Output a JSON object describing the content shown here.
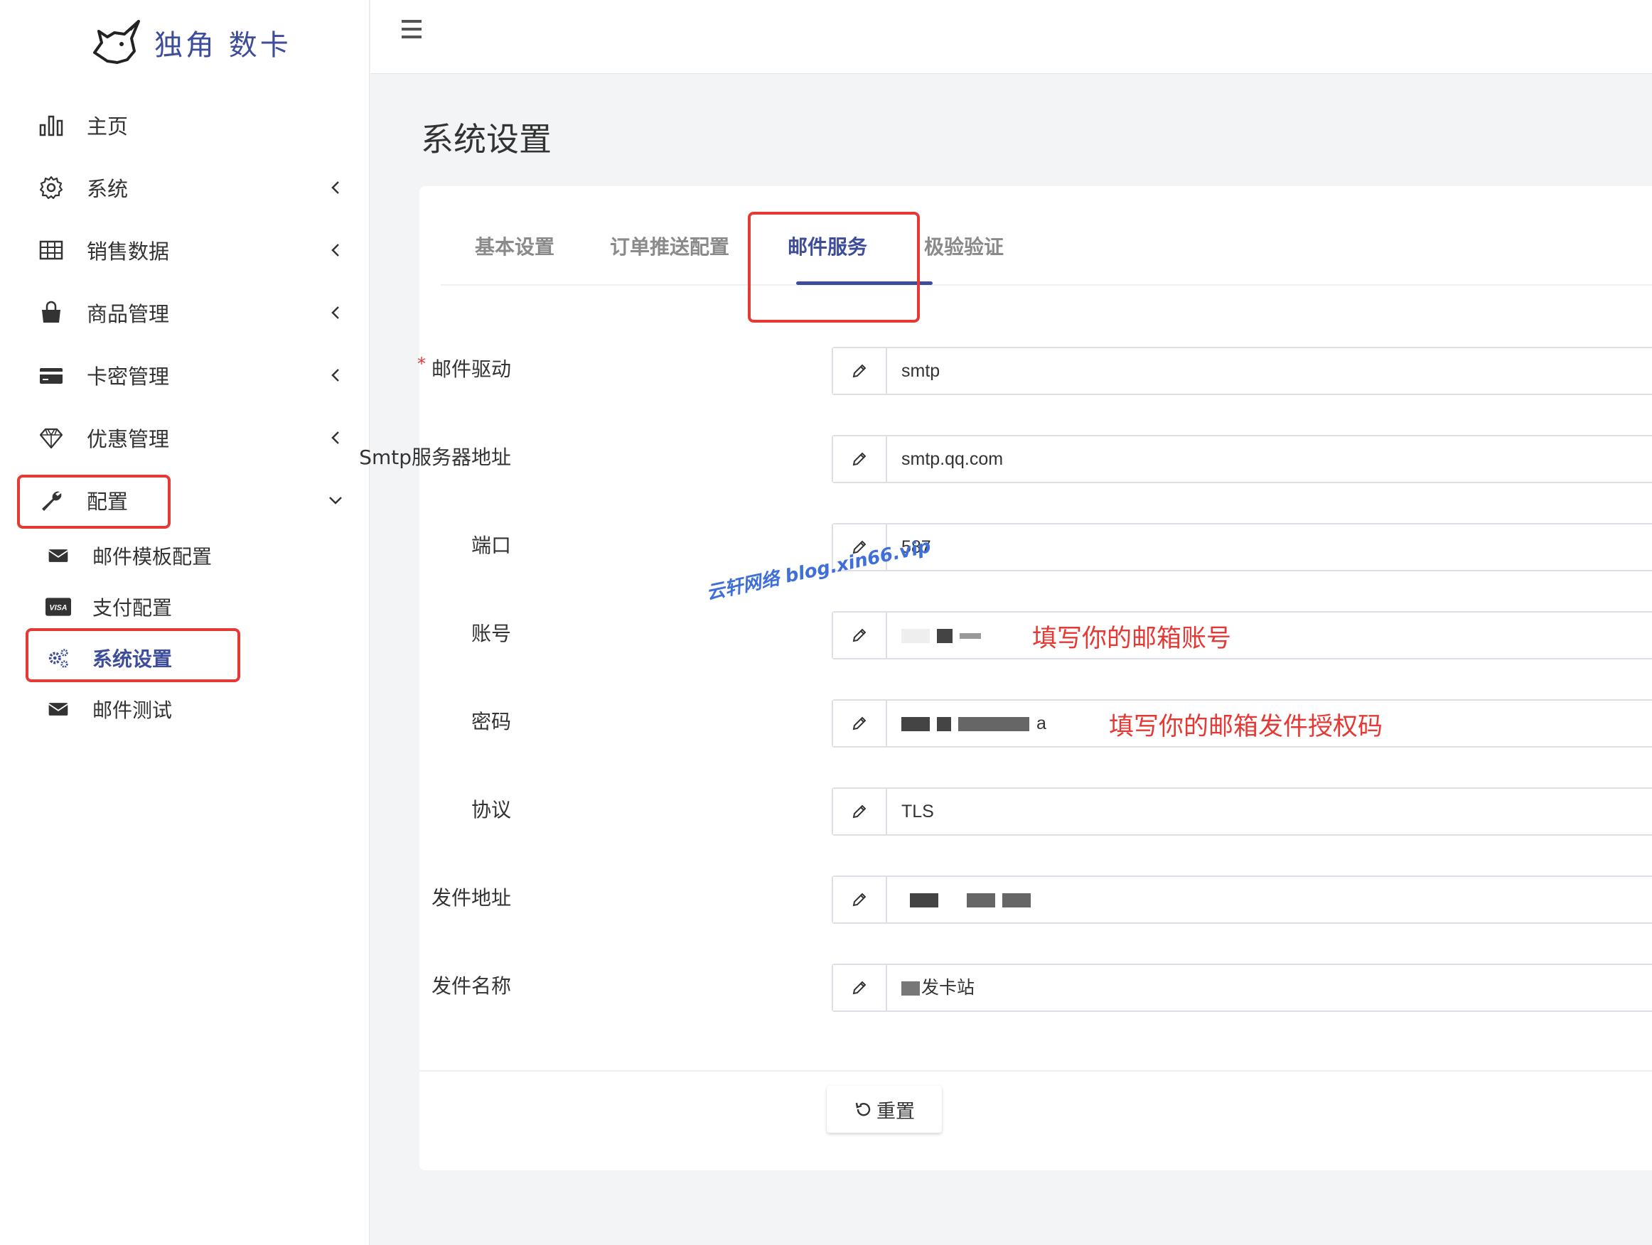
{
  "app": {
    "logo_text": "独角 数卡"
  },
  "sidebar": {
    "items": [
      {
        "label": "主页",
        "icon": "bar-chart-icon"
      },
      {
        "label": "系统",
        "icon": "gear-icon"
      },
      {
        "label": "销售数据",
        "icon": "table-icon"
      },
      {
        "label": "商品管理",
        "icon": "shopping-bag-icon"
      },
      {
        "label": "卡密管理",
        "icon": "credit-card-icon"
      },
      {
        "label": "优惠管理",
        "icon": "diamond-icon"
      },
      {
        "label": "配置",
        "icon": "wrench-icon"
      }
    ],
    "subitems": [
      {
        "label": "邮件模板配置",
        "icon": "envelope-icon"
      },
      {
        "label": "支付配置",
        "icon": "visa-icon",
        "icon_text": "VISA"
      },
      {
        "label": "系统设置",
        "icon": "gears-icon"
      },
      {
        "label": "邮件测试",
        "icon": "envelope-icon"
      }
    ]
  },
  "page": {
    "title": "系统设置"
  },
  "tabs": [
    {
      "label": "基本设置"
    },
    {
      "label": "订单推送配置"
    },
    {
      "label": "邮件服务"
    },
    {
      "label": "极验验证"
    }
  ],
  "form": {
    "fields": [
      {
        "label": "邮件驱动",
        "required_mark": "*",
        "value": "smtp"
      },
      {
        "label": "Smtp服务器地址",
        "value": "smtp.qq.com"
      },
      {
        "label": "端口",
        "value": "587"
      },
      {
        "label": "账号",
        "value": ""
      },
      {
        "label": "密码",
        "value": "a"
      },
      {
        "label": "协议",
        "value": "TLS"
      },
      {
        "label": "发件地址",
        "value": ""
      },
      {
        "label": "发件名称",
        "value": "发卡站"
      }
    ],
    "reset_label": "重置"
  },
  "annotations": {
    "account_hint": "填写你的邮箱账号",
    "password_hint": "填写你的邮箱发件授权码",
    "watermark": "云轩网络 blog.xin66.vip"
  },
  "colors": {
    "accent": "#3d4d9c",
    "highlight_box": "#e53935"
  }
}
